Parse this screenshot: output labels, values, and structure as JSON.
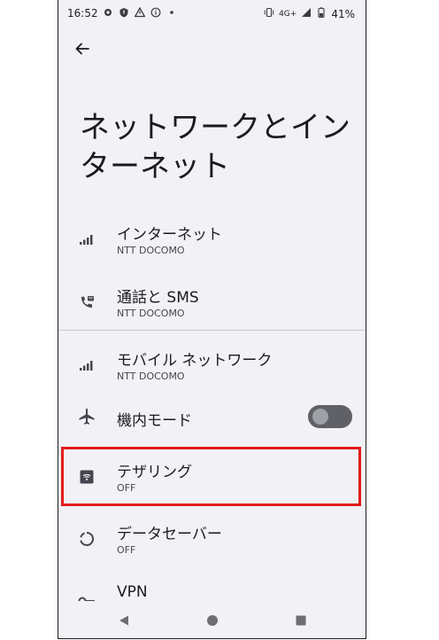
{
  "status_bar": {
    "time": "16:52",
    "network": "4G+",
    "battery": "41%"
  },
  "page": {
    "title": "ネットワークとインターネット"
  },
  "items": [
    {
      "title": "インターネット",
      "subtitle": "NTT DOCOMO",
      "icon": "signal-icon"
    },
    {
      "title": "通話と SMS",
      "subtitle": "NTT DOCOMO",
      "icon": "call-sms-icon"
    },
    {
      "title": "モバイル ネットワーク",
      "subtitle": "NTT DOCOMO",
      "icon": "signal-icon"
    },
    {
      "title": "機内モード",
      "subtitle": "",
      "icon": "airplane-icon",
      "toggle": false
    },
    {
      "title": "テザリング",
      "subtitle": "OFF",
      "icon": "hotspot-icon"
    },
    {
      "title": "データセーバー",
      "subtitle": "OFF",
      "icon": "data-saver-icon"
    },
    {
      "title": "VPN",
      "subtitle": "",
      "icon": "vpn-key-icon"
    }
  ],
  "colors": {
    "background": "#f2f1f6",
    "highlight": "#e31b1b",
    "toggle_track": "#5f6166"
  }
}
